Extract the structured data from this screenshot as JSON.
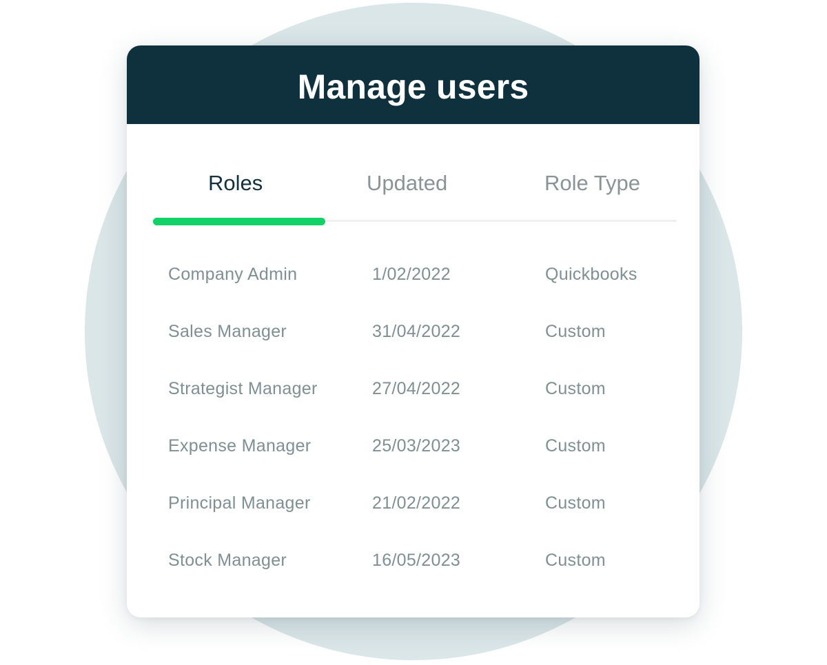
{
  "header": {
    "title": "Manage users"
  },
  "tabs": [
    {
      "label": "Roles",
      "active": true
    },
    {
      "label": "Updated",
      "active": false
    },
    {
      "label": "Role Type",
      "active": false
    }
  ],
  "colors": {
    "header_bg": "#0e313d",
    "active_indicator": "#12d166",
    "background_circle": "#dae6e8"
  },
  "table": {
    "columns": [
      "Roles",
      "Updated",
      "Role Type"
    ],
    "rows": [
      {
        "role": "Company Admin",
        "updated": "1/02/2022",
        "type": "Quickbooks"
      },
      {
        "role": "Sales Manager",
        "updated": "31/04/2022",
        "type": "Custom"
      },
      {
        "role": "Strategist Manager",
        "updated": "27/04/2022",
        "type": "Custom"
      },
      {
        "role": "Expense Manager",
        "updated": "25/03/2023",
        "type": "Custom"
      },
      {
        "role": "Principal Manager",
        "updated": "21/02/2022",
        "type": "Custom"
      },
      {
        "role": "Stock Manager",
        "updated": "16/05/2023",
        "type": "Custom"
      }
    ]
  }
}
